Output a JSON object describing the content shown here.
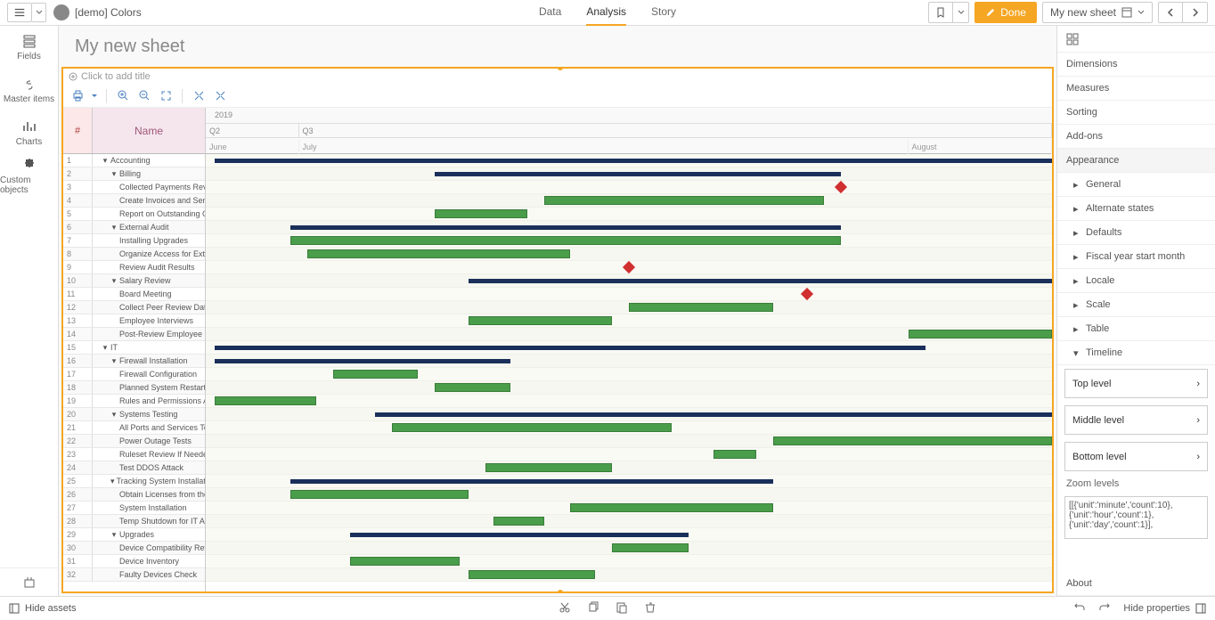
{
  "app": {
    "title": "[demo] Colors"
  },
  "topTabs": {
    "data": "Data",
    "analysis": "Analysis",
    "story": "Story"
  },
  "doneBtn": "Done",
  "sheetSelector": "My new sheet",
  "sheetTitle": "My new sheet",
  "chartTitlePlaceholder": "Click to add title",
  "leftTabs": {
    "fields": "Fields",
    "masterItems": "Master items",
    "charts": "Charts",
    "customObjects": "Custom objects"
  },
  "gantt": {
    "numHeader": "#",
    "nameHeader": "Name",
    "year": "2019",
    "quarters": [
      "Q2",
      "Q3"
    ],
    "months": [
      "June",
      "July",
      "August"
    ],
    "rows": [
      {
        "n": 1,
        "name": "Accounting",
        "lvl": 0,
        "exp": true
      },
      {
        "n": 2,
        "name": "Billing",
        "lvl": 1,
        "exp": true
      },
      {
        "n": 3,
        "name": "Collected Payments Review",
        "lvl": 2
      },
      {
        "n": 4,
        "name": "Create Invoices and Send Bi",
        "lvl": 2
      },
      {
        "n": 5,
        "name": "Report on Outstanding Col",
        "lvl": 2
      },
      {
        "n": 6,
        "name": "External Audit",
        "lvl": 1,
        "exp": true
      },
      {
        "n": 7,
        "name": "Installing Upgrades",
        "lvl": 2
      },
      {
        "n": 8,
        "name": "Organize Access for Extern",
        "lvl": 2
      },
      {
        "n": 9,
        "name": "Review Audit Results",
        "lvl": 2
      },
      {
        "n": 10,
        "name": "Salary Review",
        "lvl": 1,
        "exp": true
      },
      {
        "n": 11,
        "name": "Board Meeting",
        "lvl": 2
      },
      {
        "n": 12,
        "name": "Collect Peer Review Data",
        "lvl": 2
      },
      {
        "n": 13,
        "name": "Employee Interviews",
        "lvl": 2
      },
      {
        "n": 14,
        "name": "Post-Review Employee Inte",
        "lvl": 2
      },
      {
        "n": 15,
        "name": "IT",
        "lvl": 0,
        "exp": true
      },
      {
        "n": 16,
        "name": "Firewall Installation",
        "lvl": 1,
        "exp": true
      },
      {
        "n": 17,
        "name": "Firewall Configuration",
        "lvl": 2
      },
      {
        "n": 18,
        "name": "Planned System Restart",
        "lvl": 2
      },
      {
        "n": 19,
        "name": "Rules and Permissions Auc",
        "lvl": 2
      },
      {
        "n": 20,
        "name": "Systems Testing",
        "lvl": 1,
        "exp": true
      },
      {
        "n": 21,
        "name": "All Ports and Services Test",
        "lvl": 2
      },
      {
        "n": 22,
        "name": "Power Outage Tests",
        "lvl": 2
      },
      {
        "n": 23,
        "name": "Ruleset Review If Needed",
        "lvl": 2
      },
      {
        "n": 24,
        "name": "Test DDOS Attack",
        "lvl": 2
      },
      {
        "n": 25,
        "name": "Tracking System Installation",
        "lvl": 1,
        "exp": true
      },
      {
        "n": 26,
        "name": "Obtain Licenses from the V",
        "lvl": 2
      },
      {
        "n": 27,
        "name": "System Installation",
        "lvl": 2
      },
      {
        "n": 28,
        "name": "Temp Shutdown for IT Aud",
        "lvl": 2
      },
      {
        "n": 29,
        "name": "Upgrades",
        "lvl": 1,
        "exp": true
      },
      {
        "n": 30,
        "name": "Device Compatibility Revie",
        "lvl": 2
      },
      {
        "n": 31,
        "name": "Device Inventory",
        "lvl": 2
      },
      {
        "n": 32,
        "name": "Faulty Devices Check",
        "lvl": 2
      }
    ]
  },
  "rightPanel": {
    "dimensions": "Dimensions",
    "measures": "Measures",
    "sorting": "Sorting",
    "addons": "Add-ons",
    "appearance": "Appearance",
    "general": "General",
    "alternateStates": "Alternate states",
    "defaults": "Defaults",
    "fiscalYear": "Fiscal year start month",
    "locale": "Locale",
    "scale": "Scale",
    "table": "Table",
    "timeline": "Timeline",
    "topLevel": "Top level",
    "middleLevel": "Middle level",
    "bottomLevel": "Bottom level",
    "zoomLevels": "Zoom levels",
    "zoomValue": "[[{'unit':'minute','count':10},{'unit':'hour','count':1},{'unit':'day','count':1}],",
    "about": "About"
  },
  "bottomBar": {
    "hideAssets": "Hide assets",
    "hideProperties": "Hide properties"
  },
  "chart_data": {
    "type": "gantt",
    "title": "",
    "time_axis": {
      "year": 2019,
      "start": "2019-05",
      "end": "2019-09",
      "quarters": [
        "Q2",
        "Q3"
      ],
      "months": [
        "June",
        "July",
        "August"
      ]
    },
    "rows": [
      {
        "id": 1,
        "name": "Accounting",
        "level": 0,
        "type": "group",
        "start_pct": 1,
        "end_pct": 100
      },
      {
        "id": 2,
        "name": "Billing",
        "level": 1,
        "type": "group",
        "start_pct": 27,
        "end_pct": 75
      },
      {
        "id": 3,
        "name": "Collected Payments Review",
        "level": 2,
        "type": "milestone",
        "at_pct": 75
      },
      {
        "id": 4,
        "name": "Create Invoices and Send Bi",
        "level": 2,
        "type": "task",
        "start_pct": 40,
        "end_pct": 73
      },
      {
        "id": 5,
        "name": "Report on Outstanding Col",
        "level": 2,
        "type": "task",
        "start_pct": 27,
        "end_pct": 38
      },
      {
        "id": 6,
        "name": "External Audit",
        "level": 1,
        "type": "group",
        "start_pct": 10,
        "end_pct": 75
      },
      {
        "id": 7,
        "name": "Installing Upgrades",
        "level": 2,
        "type": "task",
        "start_pct": 10,
        "end_pct": 75
      },
      {
        "id": 8,
        "name": "Organize Access for Extern",
        "level": 2,
        "type": "task",
        "start_pct": 12,
        "end_pct": 43
      },
      {
        "id": 9,
        "name": "Review Audit Results",
        "level": 2,
        "type": "milestone",
        "at_pct": 50
      },
      {
        "id": 10,
        "name": "Salary Review",
        "level": 1,
        "type": "group",
        "start_pct": 31,
        "end_pct": 100
      },
      {
        "id": 11,
        "name": "Board Meeting",
        "level": 2,
        "type": "milestone",
        "at_pct": 71
      },
      {
        "id": 12,
        "name": "Collect Peer Review Data",
        "level": 2,
        "type": "task",
        "start_pct": 50,
        "end_pct": 67
      },
      {
        "id": 13,
        "name": "Employee Interviews",
        "level": 2,
        "type": "task",
        "start_pct": 31,
        "end_pct": 48
      },
      {
        "id": 14,
        "name": "Post-Review Employee Inte",
        "level": 2,
        "type": "task",
        "start_pct": 83,
        "end_pct": 100
      },
      {
        "id": 15,
        "name": "IT",
        "level": 0,
        "type": "group",
        "start_pct": 1,
        "end_pct": 85
      },
      {
        "id": 16,
        "name": "Firewall Installation",
        "level": 1,
        "type": "group",
        "start_pct": 1,
        "end_pct": 36
      },
      {
        "id": 17,
        "name": "Firewall Configuration",
        "level": 2,
        "type": "task",
        "start_pct": 15,
        "end_pct": 25
      },
      {
        "id": 18,
        "name": "Planned System Restart",
        "level": 2,
        "type": "task",
        "start_pct": 27,
        "end_pct": 36
      },
      {
        "id": 19,
        "name": "Rules and Permissions Auc",
        "level": 2,
        "type": "task",
        "start_pct": 1,
        "end_pct": 13
      },
      {
        "id": 20,
        "name": "Systems Testing",
        "level": 1,
        "type": "group",
        "start_pct": 20,
        "end_pct": 100
      },
      {
        "id": 21,
        "name": "All Ports and Services Test",
        "level": 2,
        "type": "task",
        "start_pct": 22,
        "end_pct": 55
      },
      {
        "id": 22,
        "name": "Power Outage Tests",
        "level": 2,
        "type": "task",
        "start_pct": 67,
        "end_pct": 100
      },
      {
        "id": 23,
        "name": "Ruleset Review If Needed",
        "level": 2,
        "type": "task",
        "start_pct": 60,
        "end_pct": 65
      },
      {
        "id": 24,
        "name": "Test DDOS Attack",
        "level": 2,
        "type": "task",
        "start_pct": 33,
        "end_pct": 48
      },
      {
        "id": 25,
        "name": "Tracking System Installation",
        "level": 1,
        "type": "group",
        "start_pct": 10,
        "end_pct": 67
      },
      {
        "id": 26,
        "name": "Obtain Licenses from the V",
        "level": 2,
        "type": "task",
        "start_pct": 10,
        "end_pct": 31
      },
      {
        "id": 27,
        "name": "System Installation",
        "level": 2,
        "type": "task",
        "start_pct": 43,
        "end_pct": 67
      },
      {
        "id": 28,
        "name": "Temp Shutdown for IT Aud",
        "level": 2,
        "type": "task",
        "start_pct": 34,
        "end_pct": 40
      },
      {
        "id": 29,
        "name": "Upgrades",
        "level": 1,
        "type": "group",
        "start_pct": 17,
        "end_pct": 57
      },
      {
        "id": 30,
        "name": "Device Compatibility Revie",
        "level": 2,
        "type": "task",
        "start_pct": 48,
        "end_pct": 57
      },
      {
        "id": 31,
        "name": "Device Inventory",
        "level": 2,
        "type": "task",
        "start_pct": 17,
        "end_pct": 30
      },
      {
        "id": 32,
        "name": "Faulty Devices Check",
        "level": 2,
        "type": "task",
        "start_pct": 31,
        "end_pct": 46
      }
    ]
  }
}
